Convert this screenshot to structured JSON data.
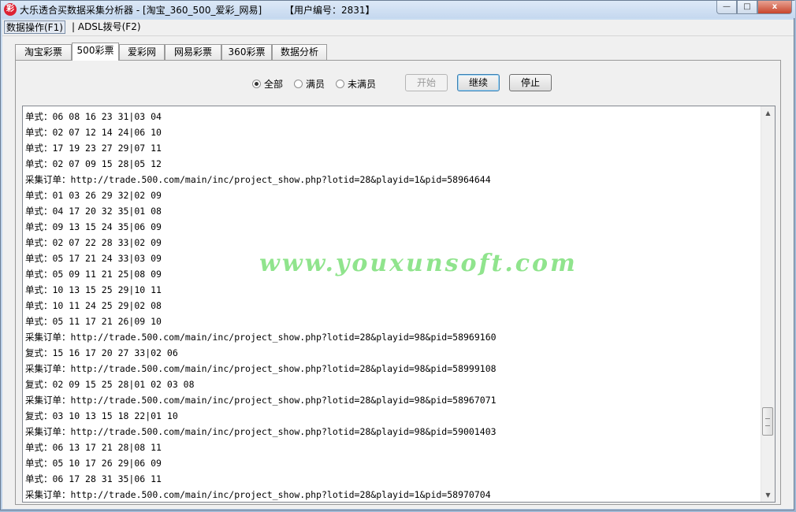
{
  "window": {
    "title": "大乐透合买数据采集分析器 - [淘宝_360_500_爱彩_网易]",
    "user_label": "【用户编号：2831】",
    "app_icon_char": "彩",
    "minimize_glyph": "—",
    "maximize_glyph": "□",
    "close_glyph": "x"
  },
  "menu": {
    "items": [
      "数据操作(F1)",
      "| ADSL拨号(F2)"
    ]
  },
  "tabs": [
    "淘宝彩票",
    "500彩票",
    "爱彩网",
    "网易彩票",
    "360彩票",
    "数据分析"
  ],
  "selected_tab": "500彩票",
  "filter": {
    "options": [
      "全部",
      "满员",
      "未满员"
    ],
    "selected": "全部"
  },
  "buttons": {
    "start": "开始",
    "continue": "继续",
    "stop": "停止"
  },
  "log_lines": [
    "单式：06 08 16 23 31|03 04",
    "单式：02 07 12 14 24|06 10",
    "单式：17 19 23 27 29|07 11",
    "单式：02 07 09 15 28|05 12",
    "采集订单：http://trade.500.com/main/inc/project_show.php?lotid=28&playid=1&pid=58964644",
    "单式：01 03 26 29 32|02 09",
    "单式：04 17 20 32 35|01 08",
    "单式：09 13 15 24 35|06 09",
    "单式：02 07 22 28 33|02 09",
    "单式：05 17 21 24 33|03 09",
    "单式：05 09 11 21 25|08 09",
    "单式：10 13 15 25 29|10 11",
    "单式：10 11 24 25 29|02 08",
    "单式：05 11 17 21 26|09 10",
    "采集订单：http://trade.500.com/main/inc/project_show.php?lotid=28&playid=98&pid=58969160",
    "复式：15 16 17 20 27 33|02 06",
    "采集订单：http://trade.500.com/main/inc/project_show.php?lotid=28&playid=98&pid=58999108",
    "复式：02 09 15 25 28|01 02 03 08",
    "采集订单：http://trade.500.com/main/inc/project_show.php?lotid=28&playid=98&pid=58967071",
    "复式：03 10 13 15 18 22|01 10",
    "采集订单：http://trade.500.com/main/inc/project_show.php?lotid=28&playid=98&pid=59001403",
    "单式：06 13 17 21 28|08 11",
    "单式：05 10 17 26 29|06 09",
    "单式：06 17 28 31 35|06 11",
    "采集订单：http://trade.500.com/main/inc/project_show.php?lotid=28&playid=1&pid=58970704"
  ],
  "watermark": "www.youxunsoft.com",
  "scroll": {
    "up_glyph": "▲",
    "down_glyph": "▼"
  }
}
